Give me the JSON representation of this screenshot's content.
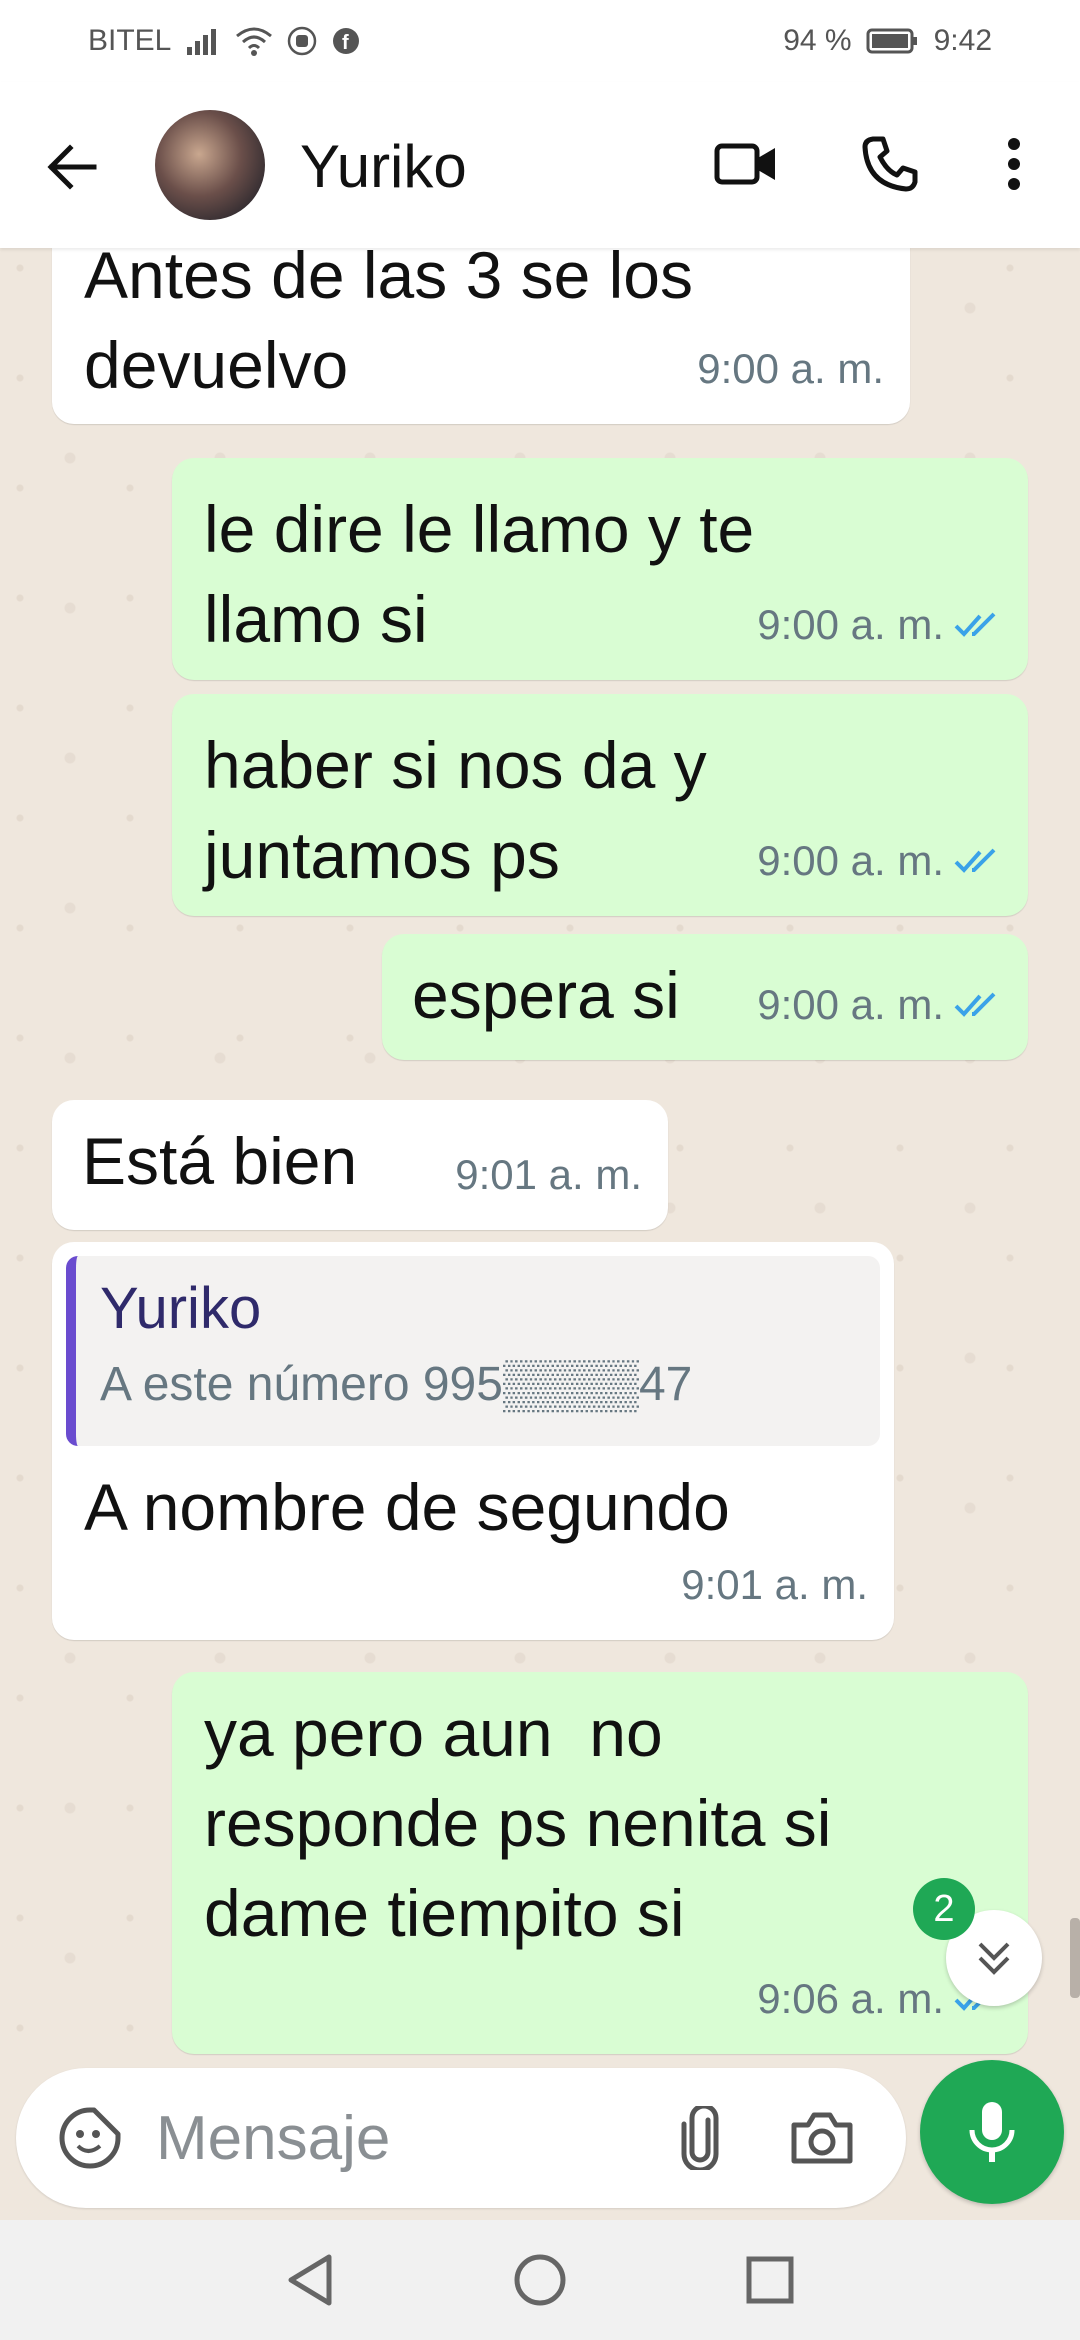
{
  "status_bar": {
    "carrier": "BITEL",
    "battery": "94 %",
    "time": "9:42"
  },
  "header": {
    "contact_name": "Yuriko"
  },
  "messages": [
    {
      "direction": "in",
      "text": "Antes de las 3 se los\ndevuelvo",
      "time": "9:00 a. m."
    },
    {
      "direction": "out",
      "text": "le dire le llamo y te\nllamo si",
      "time": "9:00 a. m.",
      "status": "read"
    },
    {
      "direction": "out",
      "text": "haber si nos da y\njuntamos ps",
      "time": "9:00 a. m.",
      "status": "read"
    },
    {
      "direction": "out",
      "text": "espera si",
      "time": "9:00 a. m.",
      "status": "read"
    },
    {
      "direction": "in",
      "text": "Está bien",
      "time": "9:01 a. m."
    },
    {
      "direction": "in",
      "quote_name": "Yuriko",
      "quote_text": "A este número 995▒▒▒▒47",
      "text": "A nombre de segundo",
      "time": "9:01 a. m."
    },
    {
      "direction": "out",
      "text": "ya pero aun  no\nresponde ps nenita si\ndame tiempito si",
      "time": "9:06 a. m.",
      "status": "delivered"
    }
  ],
  "unread_count": "2",
  "composer": {
    "placeholder": "Mensaje"
  },
  "colors": {
    "accent": "#1fa855",
    "outgoing_bubble": "#d9fdd3",
    "incoming_bubble": "#ffffff",
    "read_ticks": "#3aa2e8",
    "quote_bar": "#6a4ccf"
  }
}
